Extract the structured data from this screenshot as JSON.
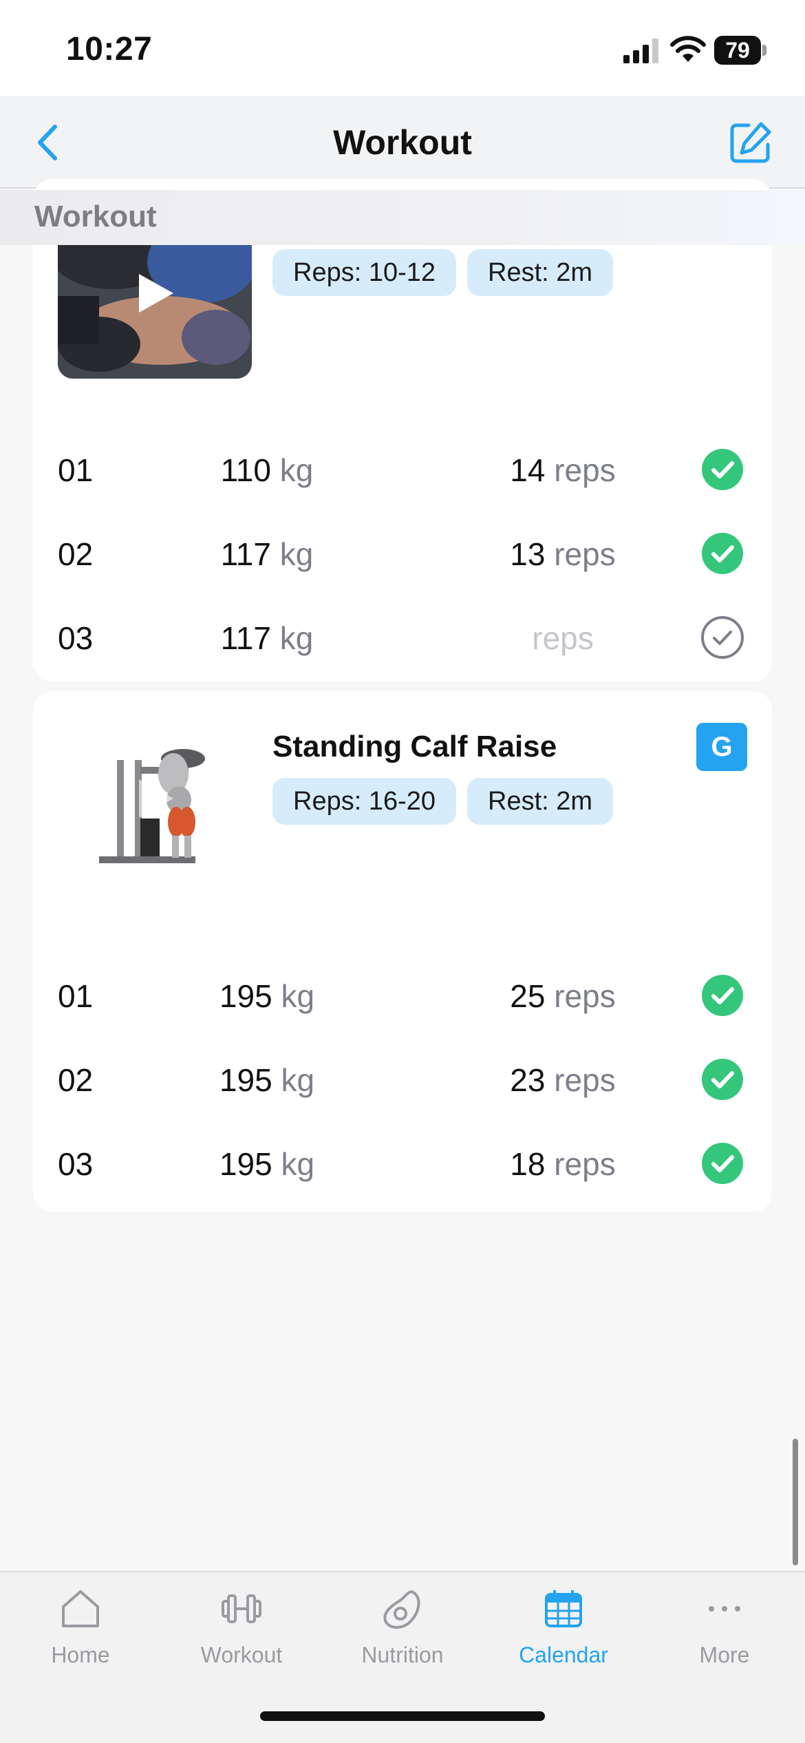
{
  "status_bar": {
    "time": "10:27",
    "battery": "79"
  },
  "nav": {
    "title": "Workout"
  },
  "section_header": "Workout",
  "exercises": [
    {
      "title": "",
      "badges": [
        "Reps: 10-12",
        "Rest: 2m"
      ],
      "sets": [
        {
          "num": "01",
          "weight": "110",
          "weight_unit": "kg",
          "reps": "14",
          "reps_unit": "reps",
          "done": true
        },
        {
          "num": "02",
          "weight": "117",
          "weight_unit": "kg",
          "reps": "13",
          "reps_unit": "reps",
          "done": true
        },
        {
          "num": "03",
          "weight": "117",
          "weight_unit": "kg",
          "reps": "",
          "reps_unit": "reps",
          "done": false
        }
      ]
    },
    {
      "title": "Standing Calf Raise",
      "guide_badge": "G",
      "badges": [
        "Reps: 16-20",
        "Rest: 2m"
      ],
      "sets": [
        {
          "num": "01",
          "weight": "195",
          "weight_unit": "kg",
          "reps": "25",
          "reps_unit": "reps",
          "done": true
        },
        {
          "num": "02",
          "weight": "195",
          "weight_unit": "kg",
          "reps": "23",
          "reps_unit": "reps",
          "done": true
        },
        {
          "num": "03",
          "weight": "195",
          "weight_unit": "kg",
          "reps": "18",
          "reps_unit": "reps",
          "done": true
        }
      ]
    }
  ],
  "tabs": [
    {
      "label": "Home",
      "icon": "home-icon",
      "active": false
    },
    {
      "label": "Workout",
      "icon": "dumbbell-icon",
      "active": false
    },
    {
      "label": "Nutrition",
      "icon": "avocado-icon",
      "active": false
    },
    {
      "label": "Calendar",
      "icon": "calendar-icon",
      "active": true
    },
    {
      "label": "More",
      "icon": "more-icon",
      "active": false
    }
  ],
  "colors": {
    "accent": "#23a3f0",
    "check_done": "#34c77b",
    "badge_bg": "#d6ecfb",
    "unit_text": "#7c7e8a"
  }
}
